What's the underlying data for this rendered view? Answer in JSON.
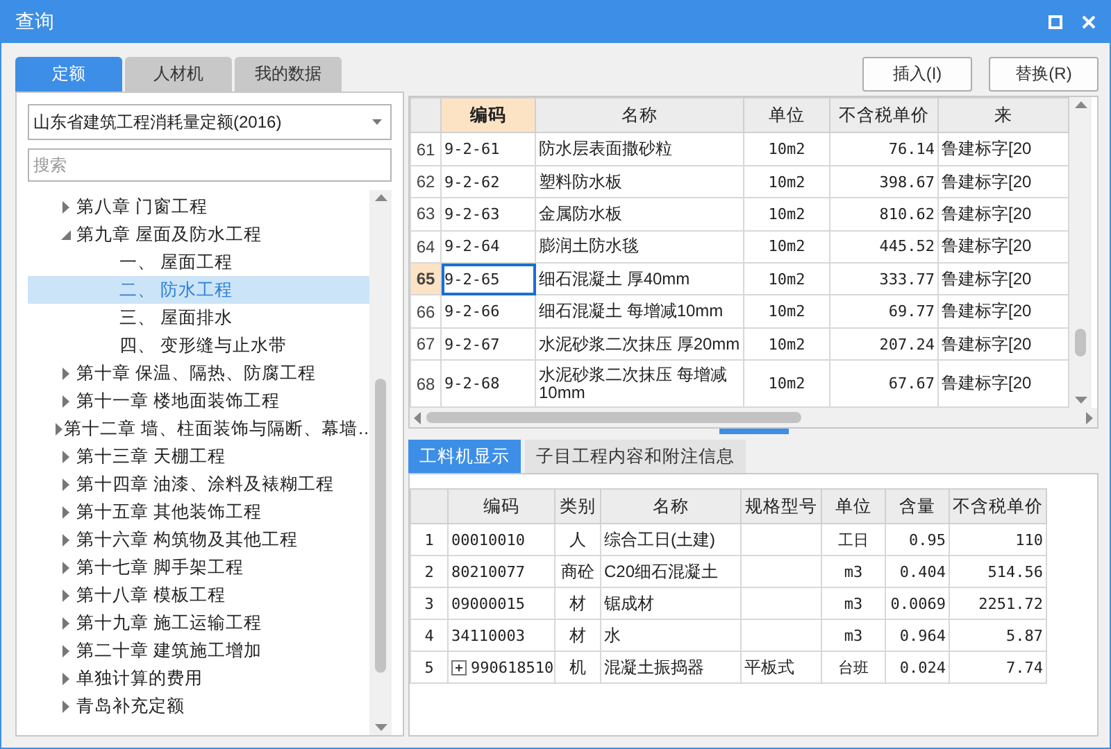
{
  "window": {
    "title": "查询"
  },
  "left_tabs": [
    {
      "label": "定额",
      "selected": true
    },
    {
      "label": "人材机",
      "selected": false
    },
    {
      "label": "我的数据",
      "selected": false
    }
  ],
  "quota_select": {
    "value": "山东省建筑工程消耗量定额(2016)"
  },
  "search": {
    "placeholder": "搜索"
  },
  "tree": [
    {
      "label": "第八章 门窗工程",
      "expanded": false,
      "selected": false
    },
    {
      "label": "第九章 屋面及防水工程",
      "expanded": true,
      "selected": false,
      "children": [
        {
          "label": "一、 屋面工程",
          "selected": false
        },
        {
          "label": "二、 防水工程",
          "selected": true
        },
        {
          "label": "三、 屋面排水",
          "selected": false
        },
        {
          "label": "四、 变形缝与止水带",
          "selected": false
        }
      ]
    },
    {
      "label": "第十章 保温、隔热、防腐工程",
      "expanded": false,
      "selected": false
    },
    {
      "label": "第十一章 楼地面装饰工程",
      "expanded": false,
      "selected": false
    },
    {
      "label": "第十二章 墙、柱面装饰与隔断、幕墙…",
      "expanded": false,
      "selected": false
    },
    {
      "label": "第十三章 天棚工程",
      "expanded": false,
      "selected": false
    },
    {
      "label": "第十四章 油漆、涂料及裱糊工程",
      "expanded": false,
      "selected": false
    },
    {
      "label": "第十五章 其他装饰工程",
      "expanded": false,
      "selected": false
    },
    {
      "label": "第十六章 构筑物及其他工程",
      "expanded": false,
      "selected": false
    },
    {
      "label": "第十七章 脚手架工程",
      "expanded": false,
      "selected": false
    },
    {
      "label": "第十八章 模板工程",
      "expanded": false,
      "selected": false
    },
    {
      "label": "第十九章 施工运输工程",
      "expanded": false,
      "selected": false
    },
    {
      "label": "第二十章 建筑施工增加",
      "expanded": false,
      "selected": false
    },
    {
      "label": "单独计算的费用",
      "expanded": false,
      "selected": false
    },
    {
      "label": "青岛补充定额",
      "expanded": false,
      "selected": false
    }
  ],
  "buttons": [
    "插入(I)",
    "替换(R)"
  ],
  "quota_table": {
    "columns": [
      {
        "label": "编码",
        "selected": true
      },
      {
        "label": "名称",
        "selected": false
      },
      {
        "label": "单位",
        "selected": false
      },
      {
        "label": "不含税单价",
        "selected": false
      },
      {
        "label": "来",
        "selected": false
      }
    ],
    "rows": [
      {
        "index": "61",
        "code": "9-2-61",
        "name": "防水层表面撒砂粒",
        "unit": "10m2",
        "price": "76.14",
        "source": "鲁建标字[20",
        "selected": false
      },
      {
        "index": "62",
        "code": "9-2-62",
        "name": "塑料防水板",
        "unit": "10m2",
        "price": "398.67",
        "source": "鲁建标字[20",
        "selected": false
      },
      {
        "index": "63",
        "code": "9-2-63",
        "name": "金属防水板",
        "unit": "10m2",
        "price": "810.62",
        "source": "鲁建标字[20",
        "selected": false
      },
      {
        "index": "64",
        "code": "9-2-64",
        "name": "膨润土防水毯",
        "unit": "10m2",
        "price": "445.52",
        "source": "鲁建标字[20",
        "selected": false
      },
      {
        "index": "65",
        "code": "9-2-65",
        "name": "细石混凝土 厚40mm",
        "unit": "10m2",
        "price": "333.77",
        "source": "鲁建标字[20",
        "selected": true
      },
      {
        "index": "66",
        "code": "9-2-66",
        "name": "细石混凝土 每增减10mm",
        "unit": "10m2",
        "price": "69.77",
        "source": "鲁建标字[20",
        "selected": false
      },
      {
        "index": "67",
        "code": "9-2-67",
        "name": "水泥砂浆二次抹压 厚20mm",
        "unit": "10m2",
        "price": "207.24",
        "source": "鲁建标字[20",
        "selected": false
      },
      {
        "index": "68",
        "code": "9-2-68",
        "name": "水泥砂浆二次抹压 每增减10mm",
        "unit": "10m2",
        "price": "67.67",
        "source": "鲁建标字[20",
        "selected": false
      }
    ]
  },
  "detail_tabs": [
    {
      "label": "工料机显示",
      "selected": true
    },
    {
      "label": "子目工程内容和附注信息",
      "selected": false
    }
  ],
  "resource_table": {
    "columns": [
      "编码",
      "类别",
      "名称",
      "规格型号",
      "单位",
      "含量",
      "不含税单价"
    ],
    "rows": [
      {
        "index": "1",
        "code": "00010010",
        "category": "人",
        "name": "综合工日(土建)",
        "unit": "工日",
        "amount": "0.95",
        "price": "110",
        "expandable": false
      },
      {
        "index": "2",
        "code": "80210077",
        "category": "商砼",
        "name": "C20细石混凝土",
        "unit": "m3",
        "amount": "0.404",
        "price": "514.56",
        "expandable": false
      },
      {
        "index": "3",
        "code": "09000015",
        "category": "材",
        "name": "锯成材",
        "unit": "m3",
        "amount": "0.0069",
        "price": "2251.72",
        "expandable": false
      },
      {
        "index": "4",
        "code": "34110003",
        "category": "材",
        "name": "水",
        "unit": "m3",
        "amount": "0.964",
        "price": "5.87",
        "expandable": false
      },
      {
        "index": "5",
        "code": "990618510",
        "category": "机",
        "name": "混凝土振捣器",
        "spec": "平板式",
        "unit": "台班",
        "amount": "0.024",
        "price": "7.74",
        "expandable": true
      }
    ]
  }
}
